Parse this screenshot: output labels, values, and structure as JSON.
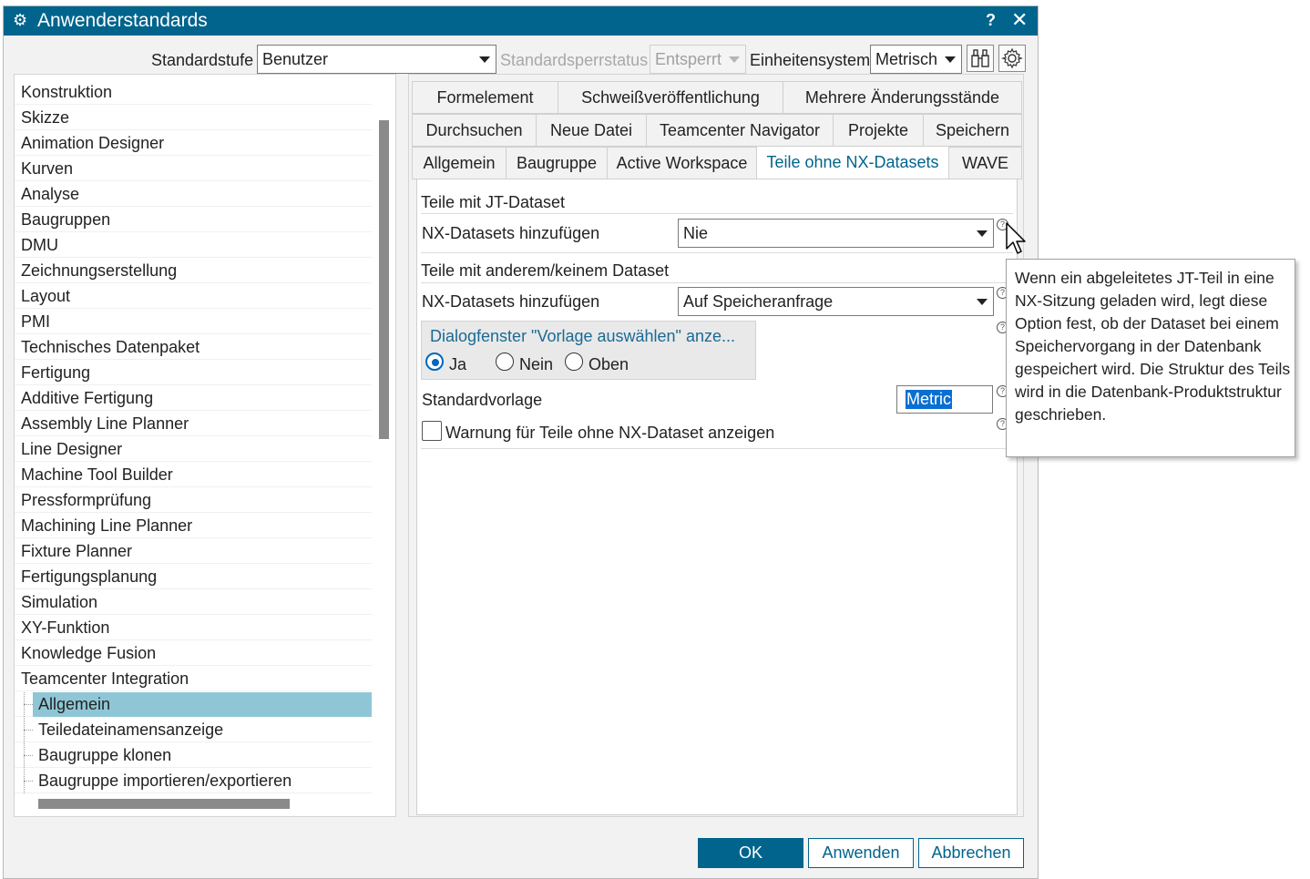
{
  "window": {
    "title": "Anwenderstandards",
    "help_symbol": "?",
    "close_symbol": "✕",
    "title_icon": "gear-icon"
  },
  "toolbar": {
    "standardstufe_label": "Standardstufe",
    "standardstufe_value": "Benutzer",
    "sperrstatus_label": "Standardsperrstatus",
    "sperrstatus_value": "Entsperrt",
    "einheitensystem_label": "Einheitensystem",
    "einheitensystem_value": "Metrisch"
  },
  "tree": {
    "items": [
      {
        "label": "Konstruktion"
      },
      {
        "label": "Skizze"
      },
      {
        "label": "Animation Designer"
      },
      {
        "label": "Kurven"
      },
      {
        "label": "Analyse"
      },
      {
        "label": "Baugruppen"
      },
      {
        "label": "DMU"
      },
      {
        "label": "Zeichnungserstellung"
      },
      {
        "label": "Layout"
      },
      {
        "label": "PMI"
      },
      {
        "label": "Technisches Datenpaket"
      },
      {
        "label": "Fertigung"
      },
      {
        "label": "Additive Fertigung"
      },
      {
        "label": "Assembly Line Planner"
      },
      {
        "label": "Line Designer"
      },
      {
        "label": "Machine Tool Builder"
      },
      {
        "label": "Pressformprüfung"
      },
      {
        "label": "Machining Line Planner"
      },
      {
        "label": "Fixture Planner"
      },
      {
        "label": "Fertigungsplanung"
      },
      {
        "label": "Simulation"
      },
      {
        "label": "XY-Funktion"
      },
      {
        "label": "Knowledge Fusion"
      },
      {
        "label": "Teamcenter Integration"
      }
    ],
    "children": [
      {
        "label": "Allgemein",
        "selected": true
      },
      {
        "label": "Teiledateinamensanzeige"
      },
      {
        "label": "Baugruppe klonen"
      },
      {
        "label": "Baugruppe importieren/exportieren"
      }
    ]
  },
  "tabs": {
    "row1": [
      "Formelement",
      "Schweißveröffentlichung",
      "Mehrere Änderungsstände"
    ],
    "row2": [
      "Durchsuchen",
      "Neue Datei",
      "Teamcenter Navigator",
      "Projekte",
      "Speichern"
    ],
    "row3": [
      "Allgemein",
      "Baugruppe",
      "Active Workspace",
      "Teile ohne NX-Datasets",
      "WAVE"
    ],
    "active": "Teile ohne NX-Datasets"
  },
  "content": {
    "section1_title": "Teile mit JT-Dataset",
    "section1_field_label": "NX-Datasets hinzufügen",
    "section1_field_value": "Nie",
    "section2_title": "Teile mit anderem/keinem Dataset",
    "section2_field_label": "NX-Datasets hinzufügen",
    "section2_field_value": "Auf Speicheranfrage",
    "group_title": "Dialogfenster \"Vorlage auswählen\" anze...",
    "radio_options": [
      "Ja",
      "Nein",
      "Oben"
    ],
    "radio_selected": "Ja",
    "template_label": "Standardvorlage",
    "template_value": "Metric",
    "warning_checkbox_label": "Warnung für Teile ohne NX-Dataset anzeigen",
    "warning_checked": false,
    "help_symbol": "?"
  },
  "tooltip": {
    "text": "Wenn ein abgeleitetes JT-Teil in eine NX-Sitzung geladen wird, legt diese Option fest, ob der Dataset bei einem Speichervorgang in der Datenbank gespeichert wird. Die Struktur des Teils wird in die Datenbank-Produktstruktur geschrieben."
  },
  "buttons": {
    "ok": "OK",
    "apply": "Anwenden",
    "cancel": "Abbrechen"
  },
  "colors": {
    "accent": "#00648c",
    "selection": "#8fc6d6",
    "radio": "#0067b8",
    "text_selection": "#0a6ed1"
  }
}
